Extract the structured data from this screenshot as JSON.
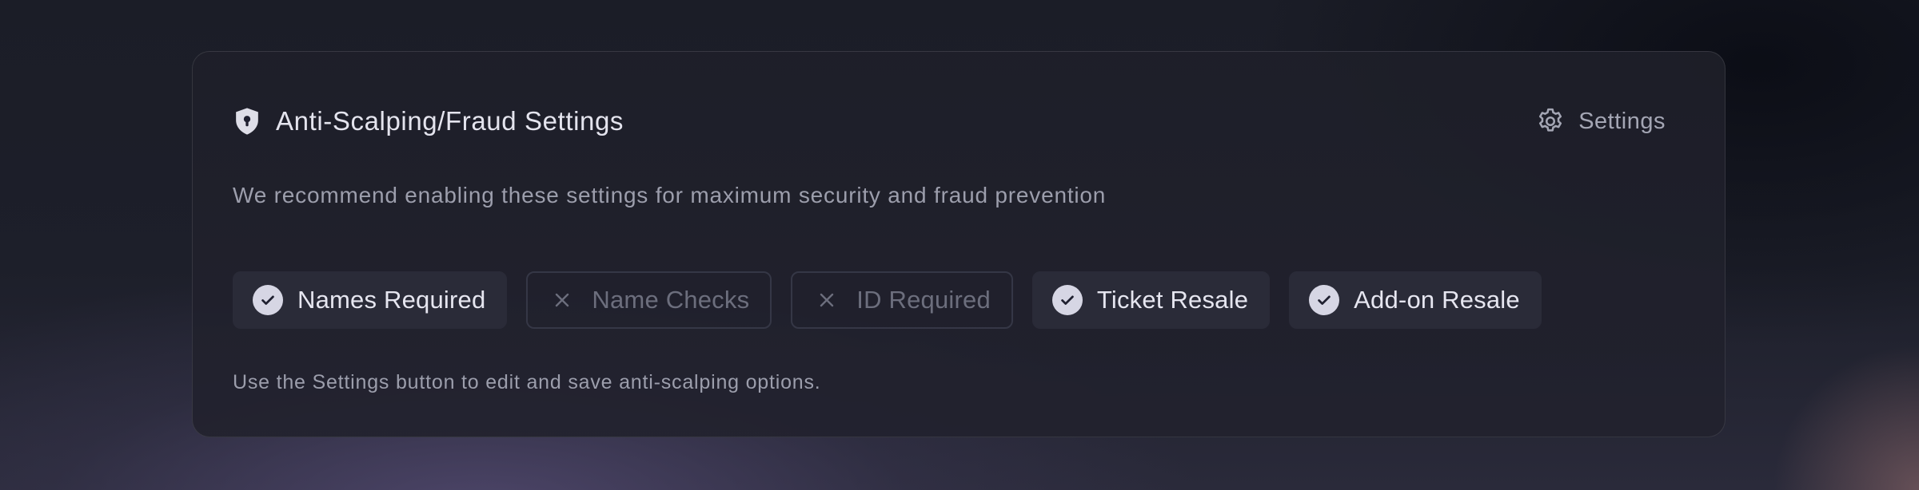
{
  "card": {
    "title": "Anti-Scalping/Fraud Settings",
    "title_icon": "shield-lock-icon",
    "settings_button": {
      "label": "Settings",
      "icon": "gear-icon"
    },
    "description": "We recommend enabling these settings for maximum security and fraud prevention",
    "options": [
      {
        "label": "Names Required",
        "enabled": true,
        "icon": "check-circle-icon"
      },
      {
        "label": "Name Checks",
        "enabled": false,
        "icon": "x-icon"
      },
      {
        "label": "ID Required",
        "enabled": false,
        "icon": "x-icon"
      },
      {
        "label": "Ticket Resale",
        "enabled": true,
        "icon": "check-circle-icon"
      },
      {
        "label": "Add-on Resale",
        "enabled": true,
        "icon": "check-circle-icon"
      }
    ],
    "footnote": "Use the Settings button to edit and save anti-scalping options."
  },
  "colors": {
    "enabled_chip_bg": "#2a2b38",
    "disabled_chip_border": "#353746",
    "check_circle": "#d6d6e4",
    "text_primary": "#e4e4ee",
    "text_muted": "#9c9eac"
  }
}
